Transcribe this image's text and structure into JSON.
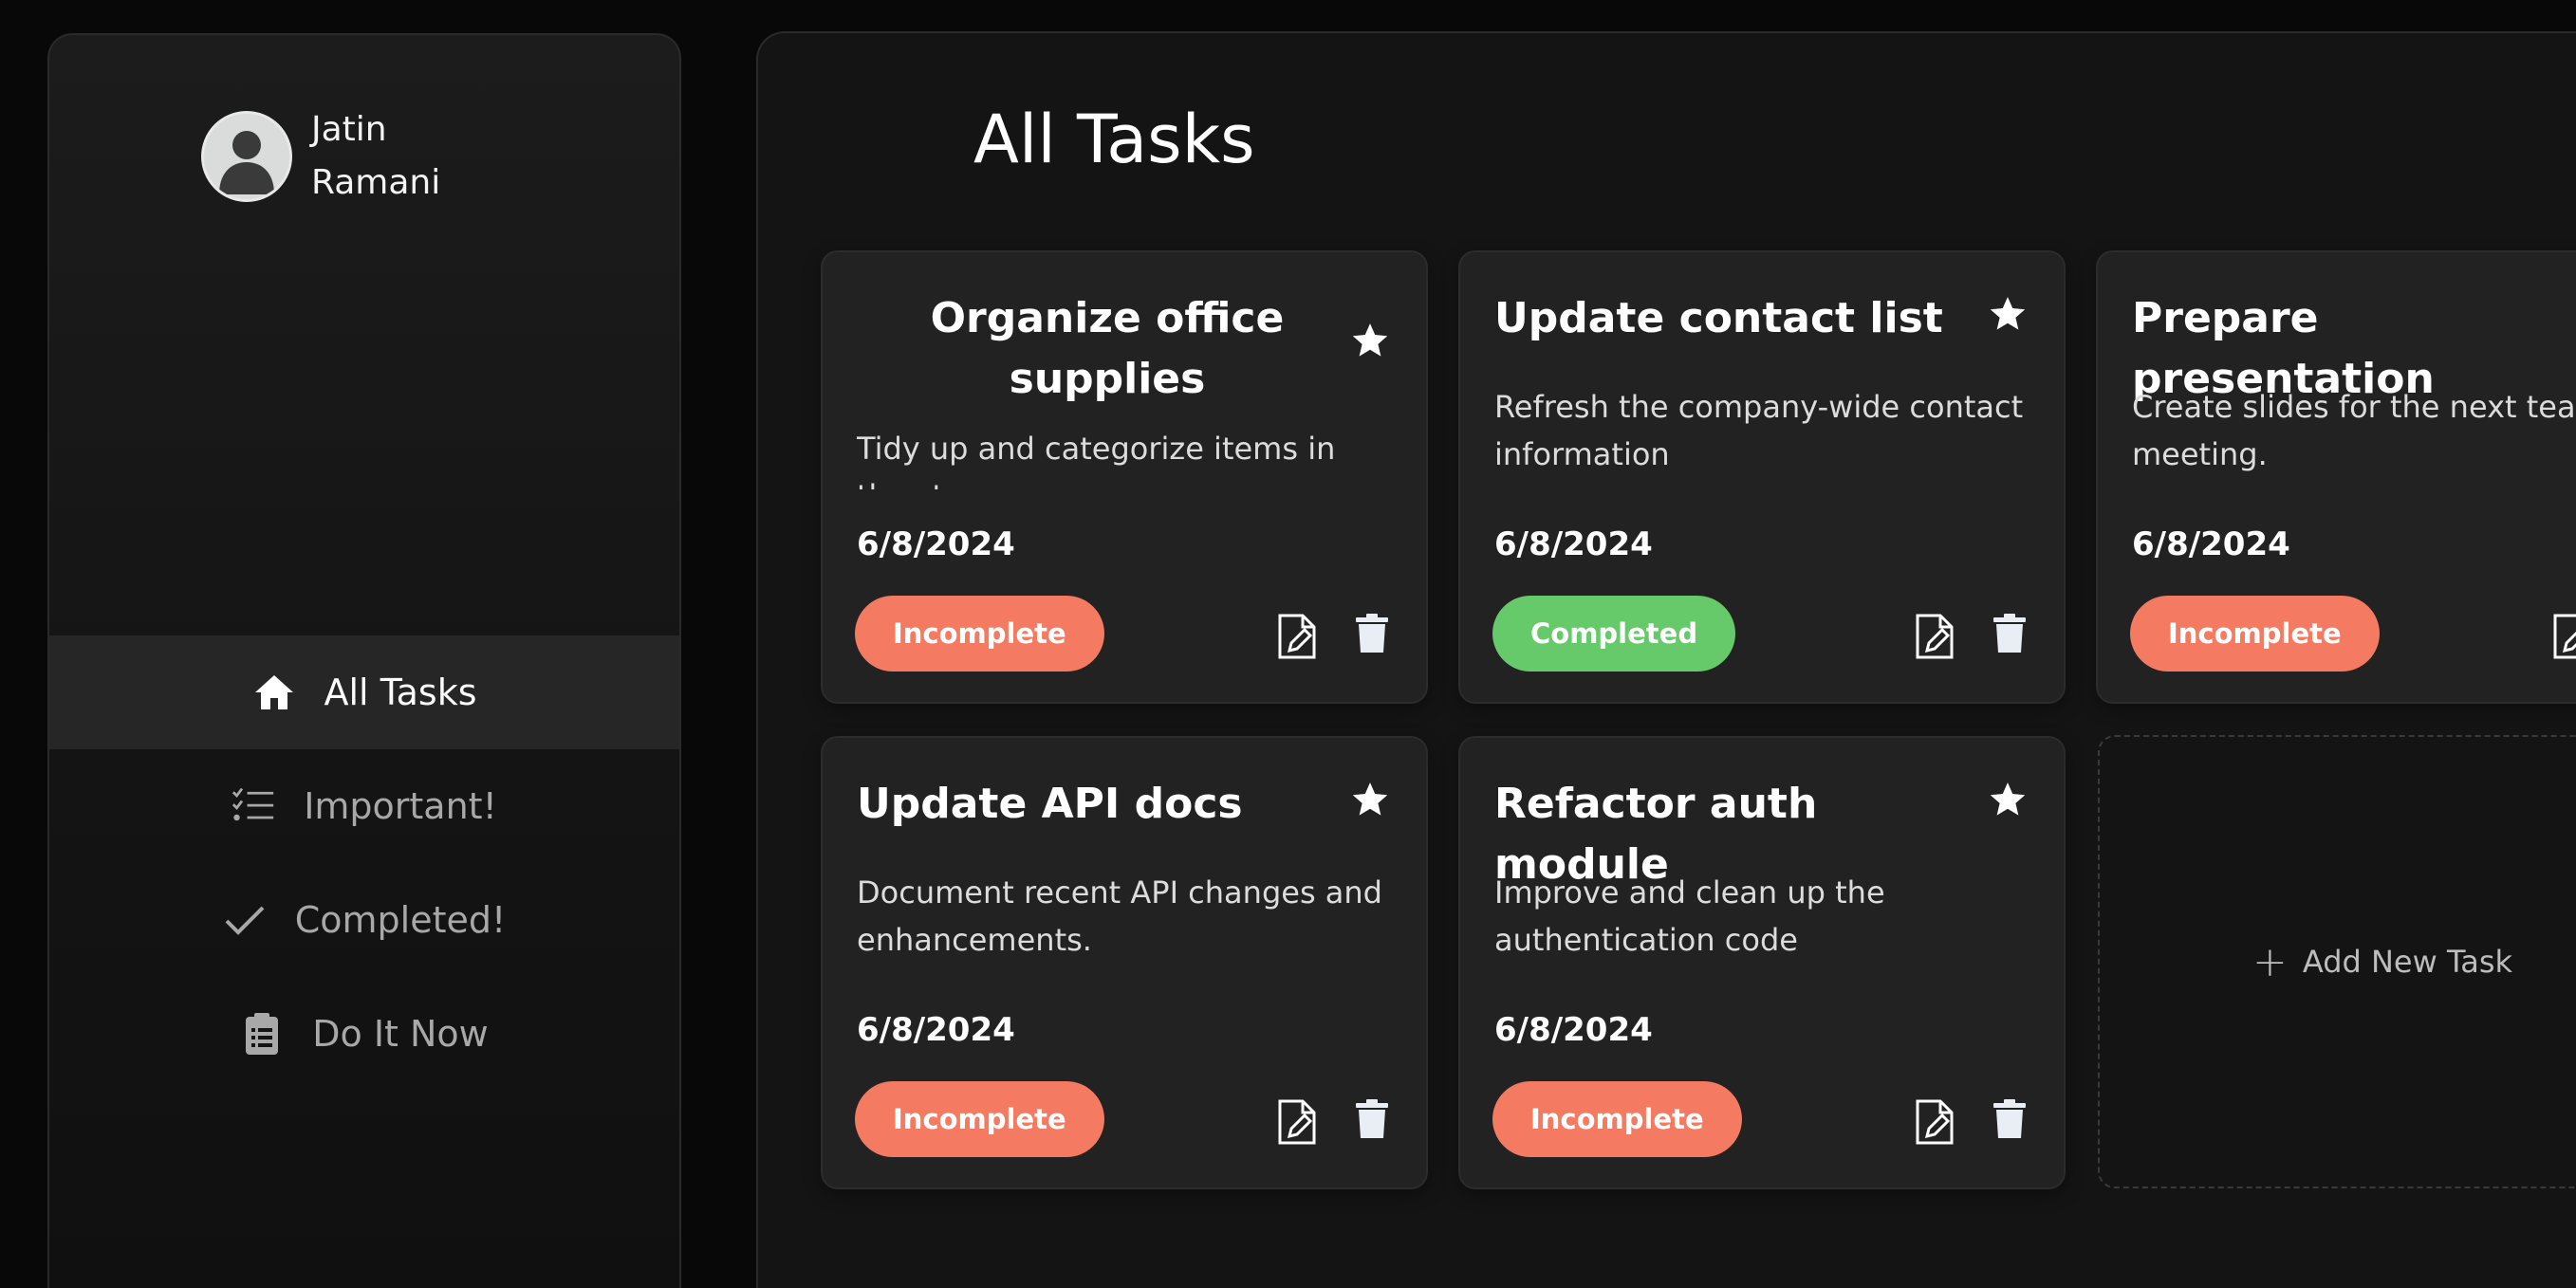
{
  "user": {
    "first_name": "Jatin",
    "last_name": "Ramani"
  },
  "nav": [
    {
      "label": "All Tasks",
      "icon": "home-icon",
      "active": true
    },
    {
      "label": "Important!",
      "icon": "checklist-icon",
      "active": false
    },
    {
      "label": "Completed!",
      "icon": "check-icon",
      "active": false
    },
    {
      "label": "Do It Now",
      "icon": "clipboard-icon",
      "active": false
    }
  ],
  "page": {
    "title": "All Tasks"
  },
  "tasks": [
    {
      "title": "Organize office supplies",
      "description": "Tidy up and categorize items in the storage room.",
      "date": "6/8/2024",
      "status": "Incomplete"
    },
    {
      "title": "Update contact list",
      "description": "Refresh the company-wide contact information",
      "date": "6/8/2024",
      "status": "Completed"
    },
    {
      "title": "Prepare presentation",
      "description": "Create slides for the next team meeting.",
      "date": "6/8/2024",
      "status": "Incomplete"
    },
    {
      "title": "Update API docs",
      "description": "Document recent API changes and enhancements.",
      "date": "6/8/2024",
      "status": "Incomplete"
    },
    {
      "title": "Refactor auth module",
      "description": "Improve and clean up the authentication code",
      "date": "6/8/2024",
      "status": "Incomplete"
    }
  ],
  "add_task": {
    "label": "Add New Task"
  },
  "colors": {
    "incomplete": "#f47a62",
    "completed": "#66c96a",
    "background": "#080808",
    "card": "#222222"
  }
}
